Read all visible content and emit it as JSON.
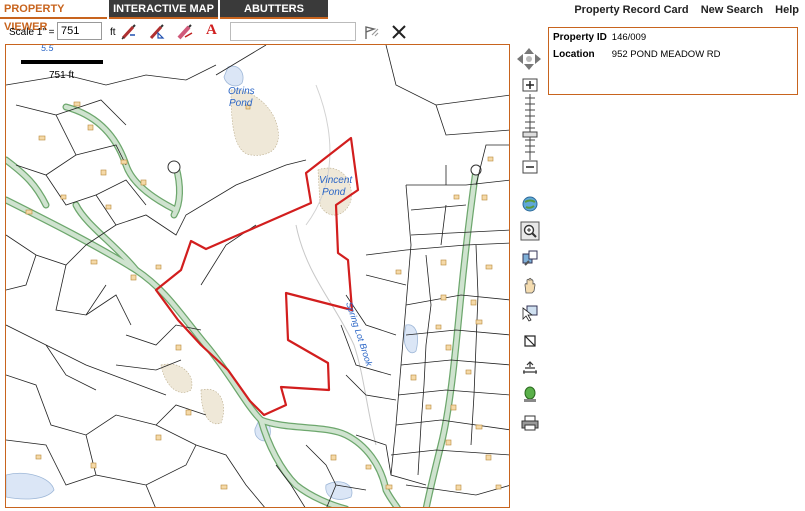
{
  "tabs": [
    {
      "label": "PROPERTY VIEWER",
      "active": true
    },
    {
      "label": "INTERACTIVE MAP",
      "active": false
    },
    {
      "label": "ABUTTERS",
      "active": false
    }
  ],
  "links": {
    "property_record_card": "Property Record Card",
    "new_search": "New Search",
    "help": "Help"
  },
  "toolbar": {
    "scale_label": "Scale 1\" =",
    "scale_value": "751",
    "ft_label": "ft",
    "text_label_tool": "A",
    "search_value": ""
  },
  "map": {
    "scale_bar_label": "751 ft",
    "labels": {
      "otrins_pond_1": "Otrins",
      "otrins_pond_2": "Pond",
      "vincent_pond_1": "Vincent",
      "vincent_pond_2": "Pond",
      "brook": "Spring Lot Brook",
      "top_fragment": "5.5"
    }
  },
  "property": {
    "id_label": "Property ID",
    "id_value": "146/009",
    "location_label": "Location",
    "location_value": "952 POND MEADOW RD"
  },
  "colors": {
    "accent": "#c8641e",
    "tab_dark": "#3a3a3a",
    "parcel_highlight": "#d21e1e",
    "road_fill": "#cfe3cf",
    "road_edge": "#6da76d",
    "water": "#dbe6f6",
    "water_label": "#2a65c6"
  },
  "icons": [
    "pan-arrows-icon",
    "zoom-in-icon",
    "zoom-out-icon",
    "globe-icon",
    "zoom-box-icon",
    "identify-icon",
    "pan-hand-icon",
    "select-icon",
    "clear-icon",
    "measure-icon",
    "marker-icon",
    "print-icon",
    "measure-pencil-icon",
    "area-pencil-icon",
    "erase-icon",
    "text-icon",
    "flag-icon",
    "close-x-icon"
  ]
}
